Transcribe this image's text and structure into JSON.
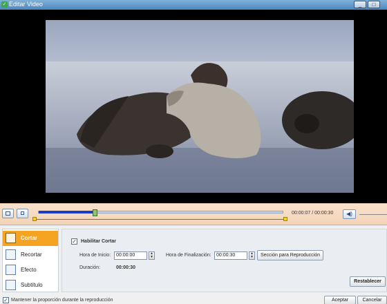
{
  "window": {
    "title": "Editar Video",
    "minimize_label": "_",
    "maximize_label": "□"
  },
  "controls": {
    "time": "00:00:07 / 00:00:30",
    "progress_fraction": 0.23
  },
  "sidebar": {
    "items": [
      {
        "label": "Cortar",
        "icon": "scissors-icon",
        "active": true
      },
      {
        "label": "Recortar",
        "icon": "crop-icon",
        "active": false
      },
      {
        "label": "Efecto",
        "icon": "effect-icon",
        "active": false
      },
      {
        "label": "Subtítulo",
        "icon": "subtitle-icon",
        "active": false
      }
    ]
  },
  "cut": {
    "enable_label": "Habilitar Cortar",
    "enable_checked": true,
    "start_label": "Hora de Inicio:",
    "start_value": "00:00:00",
    "end_label": "Hora de Finalización:",
    "end_value": "00:00:30",
    "playback_section_button": "Sección para Reproducción",
    "duration_label": "Duración:",
    "duration_value": "00:00:30",
    "reset_button": "Restablecer"
  },
  "footer": {
    "keep_ratio_label": "Mantener la proporción durante la reproducción",
    "keep_ratio_checked": true,
    "accept_button": "Aceptar",
    "cancel_button": "Cancelar"
  },
  "colors": {
    "accent": "#f4a421",
    "progress": "#1c39c8",
    "titlebar": "#4d86bd"
  }
}
